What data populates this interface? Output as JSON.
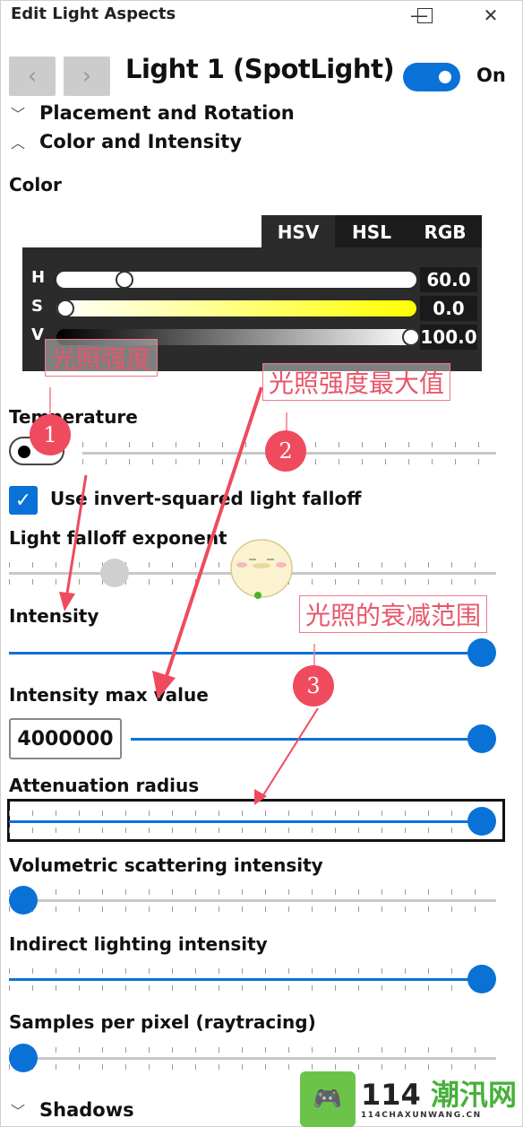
{
  "window": {
    "title": "Edit Light Aspects",
    "minimize_icon": "minimize-icon",
    "maximize_icon": "maximize-icon",
    "close_icon": "close-icon"
  },
  "header": {
    "prev_label": "‹",
    "next_label": "›",
    "light_title": "Light 1 (SpotLight)",
    "enabled_toggle": {
      "state": true,
      "label": "On"
    }
  },
  "sections": {
    "placement": {
      "label": "Placement and Rotation",
      "expanded": false
    },
    "color_intensity": {
      "label": "Color and Intensity",
      "expanded": true
    },
    "shadows": {
      "label": "Shadows",
      "expanded": false
    }
  },
  "color": {
    "label": "Color",
    "tabs": [
      "HSV",
      "HSL",
      "RGB"
    ],
    "active_tab": "HSV",
    "channels": [
      {
        "name": "H",
        "value": "60.0",
        "fraction": 0.17
      },
      {
        "name": "S",
        "value": "0.0",
        "fraction": 0.0
      },
      {
        "name": "V",
        "value": "100.0",
        "fraction": 1.0
      }
    ]
  },
  "temperature": {
    "label": "Temperature",
    "toggle_on": false,
    "fraction": 0.5
  },
  "invert_squared": {
    "label": "Use invert-squared light falloff",
    "checked": true
  },
  "falloff_exponent": {
    "label": "Light falloff exponent",
    "fraction": 0.2
  },
  "intensity": {
    "label": "Intensity",
    "fraction": 1.0
  },
  "intensity_max": {
    "label": "Intensity max value",
    "value": "4000000",
    "fraction": 1.0
  },
  "attenuation_radius": {
    "label": "Attenuation radius",
    "fraction": 1.0
  },
  "volumetric": {
    "label": "Volumetric scattering intensity",
    "fraction": 0.0
  },
  "indirect": {
    "label": "Indirect lighting intensity",
    "fraction": 1.0
  },
  "samples": {
    "label": "Samples per pixel (raytracing)",
    "fraction": 0.0
  },
  "annotations": [
    {
      "number": "1",
      "text": "光照强度"
    },
    {
      "number": "2",
      "text": "光照强度最大值"
    },
    {
      "number": "3",
      "text": "光照的衰减范围"
    }
  ],
  "watermark": {
    "main_num": "114",
    "main_cn": "潮汛网",
    "sub": "114CHAXUNWANG.CN"
  }
}
